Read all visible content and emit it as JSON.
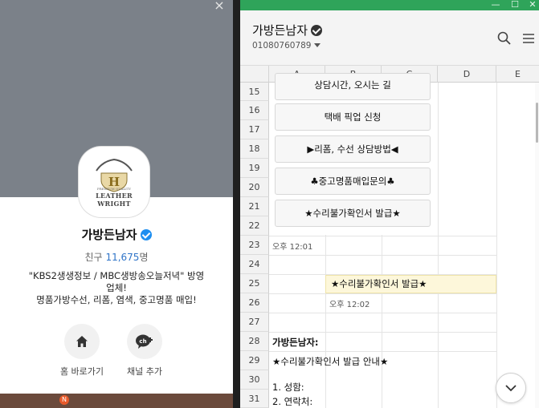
{
  "profile": {
    "name": "가방든남자",
    "friends_label": "친구",
    "friends_count": "11,675",
    "friends_unit": "명",
    "description_line1": "\"KBS2생생정보 / MBC생방송오늘저녁\" 방영",
    "description_line2": "업체!",
    "description_line3": "명품가방수선, 리폼, 염색, 중고명품 매입!",
    "logo": {
      "top": "PREMIUM QUALITY",
      "main": "LEATHER WRIGHT",
      "letter": "H"
    },
    "home_label": "홈 바로가기",
    "add_channel_label": "채널 추가",
    "close_icon": "×",
    "notif_badge": "N"
  },
  "window": {
    "minimize": "—",
    "maximize": "☐",
    "close": "✕"
  },
  "chat": {
    "name": "가방든남자",
    "phone": "01080760789"
  },
  "sheet": {
    "columns": [
      "A",
      "B",
      "C",
      "D",
      "E"
    ],
    "rows": [
      "15",
      "16",
      "17",
      "18",
      "19",
      "20",
      "21",
      "22",
      "23",
      "24",
      "25",
      "26",
      "27",
      "28",
      "29",
      "30",
      "31"
    ],
    "buttons": [
      "상담시간, 오시는 길",
      "택배 픽업 신청",
      "▶리폼, 수선 상담방법◀",
      "♣중고명품매입문의♣",
      "★수리불가확인서 발급★"
    ],
    "time1": "오후 12:01",
    "highlight": "★수리불가확인서 발급★",
    "time2": "오후 12:02",
    "sender": "가방든남자:",
    "msg_title": "★수리불가확인서 발급 안내★",
    "msg_item1": "1. 성함:",
    "msg_item2": "2. 연락처:"
  }
}
